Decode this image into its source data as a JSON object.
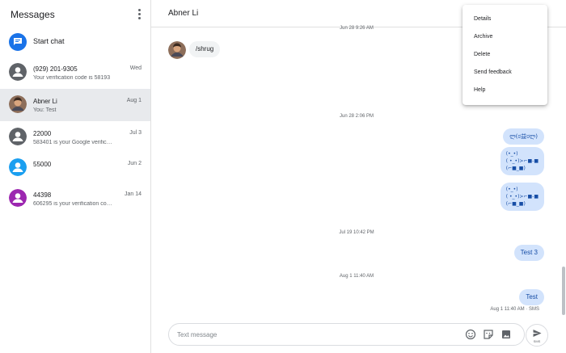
{
  "sidebar": {
    "title": "Messages",
    "start_chat_label": "Start chat",
    "conversations": [
      {
        "name": "(929) 201-9305",
        "date": "Wed",
        "snippet": "Your verification code is 58193",
        "avatar_color": "#5f6368",
        "selected": false
      },
      {
        "name": "Abner Li",
        "date": "Aug 1",
        "snippet": "You: Test",
        "avatar_color": "photo",
        "selected": true
      },
      {
        "name": "22000",
        "date": "Jul 3",
        "snippet": "583401 is your Google verific…",
        "avatar_color": "#5f6368",
        "selected": false
      },
      {
        "name": "55000",
        "date": "Jun 2",
        "snippet": "",
        "avatar_color": "#1a9ff0",
        "selected": false
      },
      {
        "name": "44398",
        "date": "Jan 14",
        "snippet": "606295 is your verification co…",
        "avatar_color": "#9c27b0",
        "selected": false
      }
    ]
  },
  "conversation": {
    "title": "Abner Li",
    "timestamps": [
      "Jun 28 9:26 AM",
      "Jun 28 2:06 PM",
      "Jul 19 10:42 PM",
      "Aug 1 11:40 AM"
    ],
    "incoming": [
      {
        "text": "/shrug"
      }
    ],
    "outgoing": [
      {
        "text": "ლ(ಠ益ಠლ)"
      },
      {
        "text": "(•_•)\n( •_•)>⌐■-■\n(⌐■_■)"
      },
      {
        "text": "(•_•)\n( •_•)>⌐■-■\n(⌐■_■)"
      },
      {
        "text": "Test 3"
      },
      {
        "text": "Test"
      }
    ],
    "delivered": "Aug 1 11:40 AM · SMS"
  },
  "composer": {
    "placeholder": "Text message",
    "send_sublabel": "SMS",
    "icons": [
      "emoji-icon",
      "sticker-icon",
      "image-icon",
      "send-icon"
    ]
  },
  "menu": {
    "items": [
      "Details",
      "Archive",
      "Delete",
      "Send feedback",
      "Help"
    ]
  },
  "colors": {
    "accent": "#1a73e8",
    "outgoing_bubble": "#d2e3fc",
    "incoming_bubble": "#f1f3f4",
    "selected_row": "#e8eaed"
  }
}
